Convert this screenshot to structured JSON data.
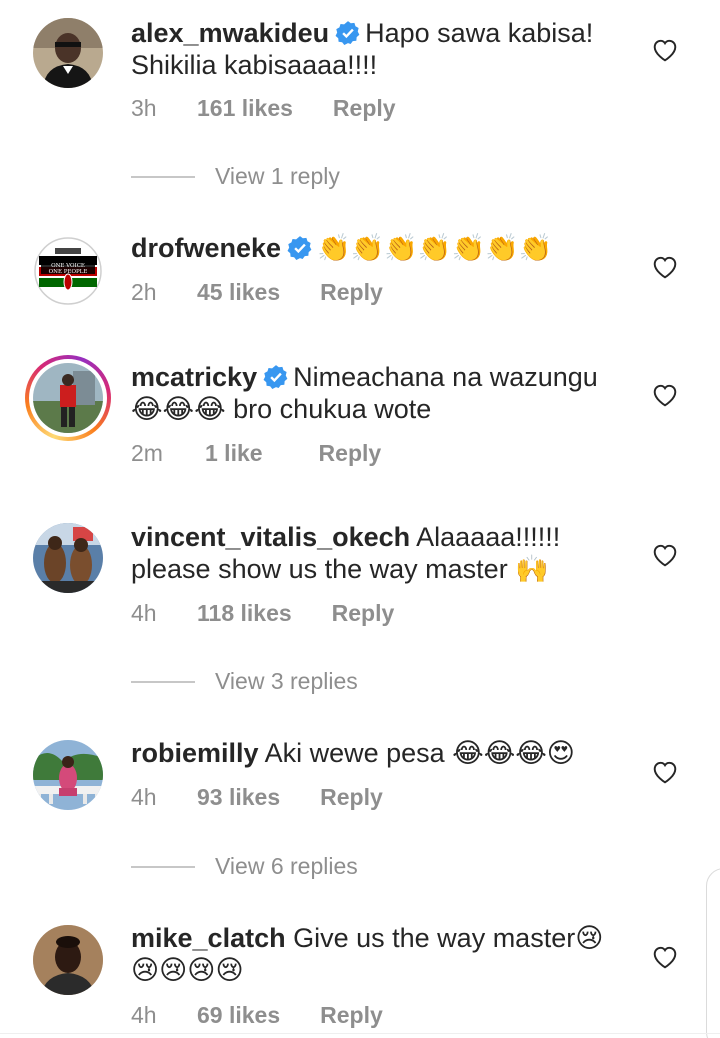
{
  "comments": [
    {
      "username": "alex_mwakideu",
      "verified": true,
      "text": "Hapo sawa kabisa! Shikilia kabisaaaa!!!!",
      "time": "3h",
      "likes": "161 likes",
      "reply": "Reply",
      "view_replies": "View 1 reply"
    },
    {
      "username": "drofweneke",
      "verified": true,
      "text": "👏👏👏👏👏👏👏",
      "time": "2h",
      "likes": "45 likes",
      "reply": "Reply",
      "avatar_text_1": "ONE VOICE",
      "avatar_text_2": "ONE PEOPLE"
    },
    {
      "username": "mcatricky",
      "verified": true,
      "text": "Nimeachana na wazungu 😂😂😂 bro chukua wote",
      "time": "2m",
      "likes": "1 like",
      "reply": "Reply"
    },
    {
      "username": "vincent_vitalis_okech",
      "verified": false,
      "text": "Alaaaaa!!!!!! please show us the way master 🙌",
      "time": "4h",
      "likes": "118 likes",
      "reply": "Reply",
      "view_replies": "View 3 replies"
    },
    {
      "username": "robiemilly",
      "verified": false,
      "text": "Aki wewe pesa 😂😂😂😍",
      "time": "4h",
      "likes": "93 likes",
      "reply": "Reply",
      "view_replies": "View 6 replies"
    },
    {
      "username": "mike_clatch",
      "verified": false,
      "text": "Give us the way master😢 😢😢😢😢",
      "time": "4h",
      "likes": "69 likes",
      "reply": "Reply"
    }
  ],
  "colors": {
    "text": "#262626",
    "muted": "#8e8e8e",
    "verified": "#3897f0"
  },
  "icons": {
    "like": "heart-outline-icon",
    "verified": "verified-badge-icon"
  }
}
